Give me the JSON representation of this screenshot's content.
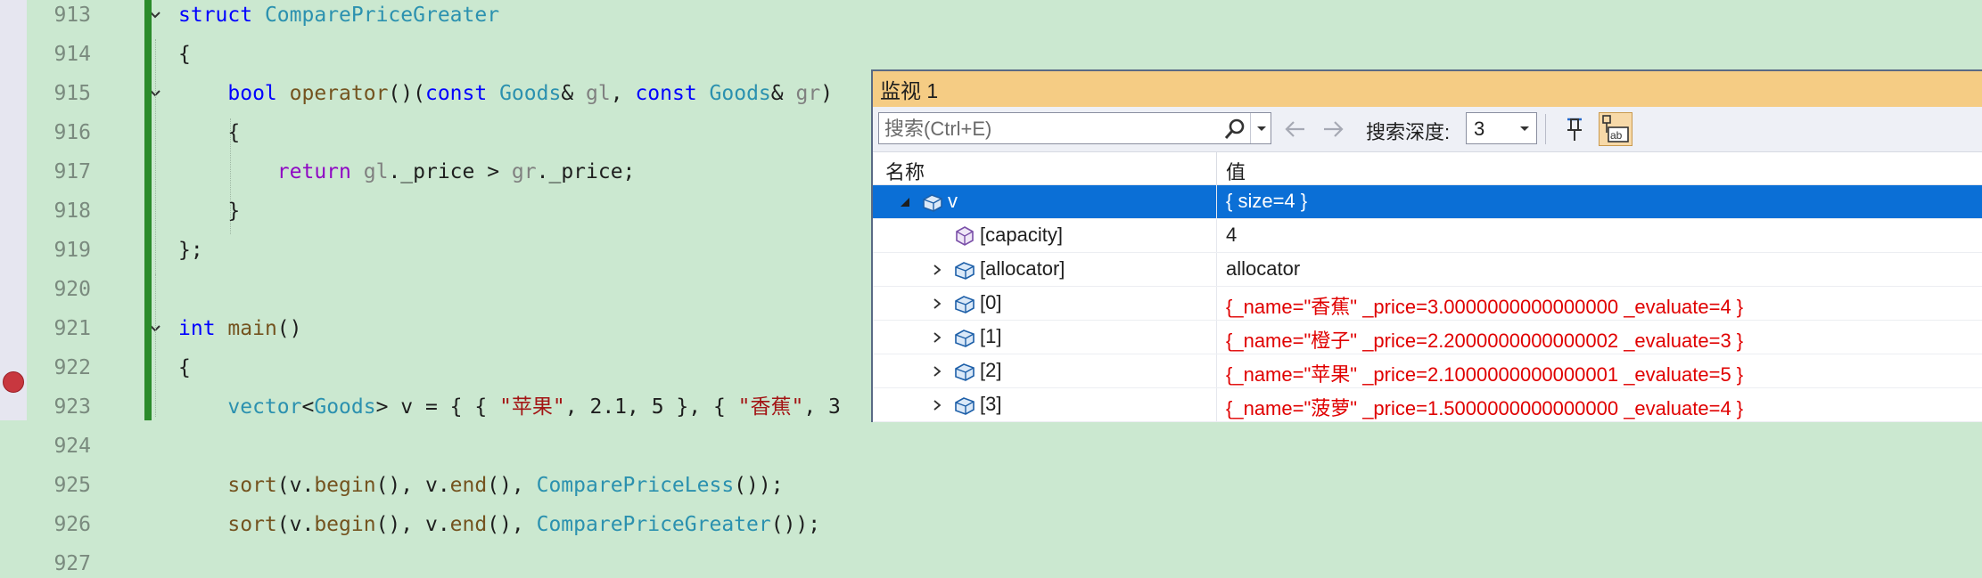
{
  "editor": {
    "lines": [
      {
        "num": "913",
        "tokens": [
          [
            "kw",
            "struct"
          ],
          [
            "",
            ""
          ],
          [
            "ty",
            "ComparePriceGreater"
          ]
        ],
        "fold": true
      },
      {
        "num": "914",
        "tokens": [
          [
            "",
            "{"
          ]
        ]
      },
      {
        "num": "915",
        "tokens": [
          [
            "",
            "    "
          ],
          [
            "kw",
            "bool"
          ],
          [
            "",
            " "
          ],
          [
            "fn",
            "operator"
          ],
          [
            "",
            "()("
          ],
          [
            "kw",
            "const"
          ],
          [
            "",
            " "
          ],
          [
            "ty",
            "Goods"
          ],
          [
            "",
            "& "
          ],
          [
            "pm",
            "gl"
          ],
          [
            "",
            ", "
          ],
          [
            "kw",
            "const"
          ],
          [
            "",
            " "
          ],
          [
            "ty",
            "Goods"
          ],
          [
            "",
            "& "
          ],
          [
            "pm",
            "gr"
          ],
          [
            "",
            ")"
          ]
        ],
        "fold": true
      },
      {
        "num": "916",
        "tokens": [
          [
            "",
            "    {"
          ]
        ]
      },
      {
        "num": "917",
        "tokens": [
          [
            "",
            "        "
          ],
          [
            "ctl",
            "return"
          ],
          [
            "",
            " "
          ],
          [
            "pm",
            "gl"
          ],
          [
            "",
            "._price > "
          ],
          [
            "pm",
            "gr"
          ],
          [
            "",
            "._price;"
          ]
        ]
      },
      {
        "num": "918",
        "tokens": [
          [
            "",
            "    }"
          ]
        ]
      },
      {
        "num": "919",
        "tokens": [
          [
            "",
            "};"
          ]
        ]
      },
      {
        "num": "920",
        "tokens": []
      },
      {
        "num": "921",
        "tokens": [
          [
            "kw",
            "int"
          ],
          [
            "",
            " "
          ],
          [
            "fn",
            "main"
          ],
          [
            "",
            "()"
          ]
        ],
        "fold": true
      },
      {
        "num": "922",
        "tokens": [
          [
            "",
            "{"
          ]
        ]
      },
      {
        "num": "923",
        "tokens": [
          [
            "",
            "    "
          ],
          [
            "ty",
            "vector"
          ],
          [
            "",
            "<"
          ],
          [
            "ty",
            "Goods"
          ],
          [
            "",
            "> v = { { "
          ],
          [
            "str",
            "\"苹果\""
          ],
          [
            "",
            ", 2.1, 5 }, { "
          ],
          [
            "str",
            "\"香蕉\""
          ],
          [
            "",
            ", 3"
          ]
        ]
      },
      {
        "num": "924",
        "tokens": []
      },
      {
        "num": "925",
        "tokens": [
          [
            "",
            "    "
          ],
          [
            "fn",
            "sort"
          ],
          [
            "",
            "(v."
          ],
          [
            "fn",
            "begin"
          ],
          [
            "",
            "(), v."
          ],
          [
            "fn",
            "end"
          ],
          [
            "",
            "(), "
          ],
          [
            "ty",
            "ComparePriceLess"
          ],
          [
            "",
            "());"
          ]
        ]
      },
      {
        "num": "926",
        "tokens": [
          [
            "",
            "    "
          ],
          [
            "fn",
            "sort"
          ],
          [
            "",
            "(v."
          ],
          [
            "fn",
            "begin"
          ],
          [
            "",
            "(), v."
          ],
          [
            "fn",
            "end"
          ],
          [
            "",
            "(), "
          ],
          [
            "ty",
            "ComparePriceGreater"
          ],
          [
            "",
            "());"
          ]
        ],
        "breakpoint": true
      },
      {
        "num": "927",
        "tokens": []
      }
    ]
  },
  "watch": {
    "title": "监视 1",
    "search_placeholder": "搜索(Ctrl+E)",
    "depth_label": "搜索深度:",
    "depth_value": "3",
    "columns": {
      "name": "名称",
      "value": "值"
    },
    "rows": [
      {
        "name": "v",
        "value": "{ size=4 }",
        "level": 0,
        "expander": "expanded",
        "icon": "object-icon",
        "selected": true
      },
      {
        "name": "[capacity]",
        "value": "4",
        "level": 1,
        "expander": "none",
        "icon": "property-icon"
      },
      {
        "name": "[allocator]",
        "value": "allocator",
        "level": 1,
        "expander": "collapsed",
        "icon": "object-icon"
      },
      {
        "name": "[0]",
        "value": "{_name=\"香蕉\" _price=3.0000000000000000 _evaluate=4 }",
        "level": 1,
        "expander": "collapsed",
        "icon": "object-icon",
        "changed": true
      },
      {
        "name": "[1]",
        "value": "{_name=\"橙子\" _price=2.2000000000000002 _evaluate=3 }",
        "level": 1,
        "expander": "collapsed",
        "icon": "object-icon",
        "changed": true
      },
      {
        "name": "[2]",
        "value": "{_name=\"苹果\" _price=2.1000000000000001 _evaluate=5 }",
        "level": 1,
        "expander": "collapsed",
        "icon": "object-icon",
        "changed": true
      },
      {
        "name": "[3]",
        "value": "{_name=\"菠萝\" _price=1.5000000000000000 _evaluate=4 }",
        "level": 1,
        "expander": "collapsed",
        "icon": "object-icon",
        "changed": true
      }
    ]
  }
}
